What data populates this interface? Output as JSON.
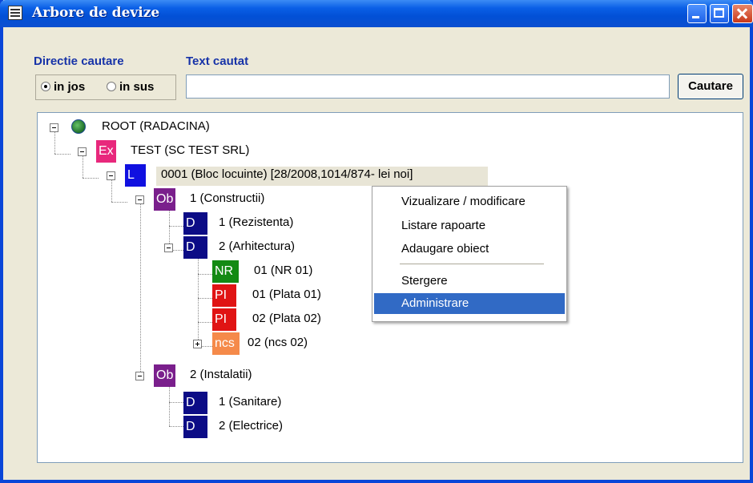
{
  "window": {
    "title": "Arbore de devize"
  },
  "search": {
    "direction_label": "Directie cautare",
    "text_label": "Text cautat",
    "option_down": "in jos",
    "option_up": "in sus",
    "selected_direction": "in jos",
    "text_value": "",
    "button_label": "Cautare"
  },
  "tree": {
    "root": {
      "label": "ROOT (RADACINA)",
      "icon": "globe-icon"
    },
    "test": {
      "tag": "Ex",
      "label": "TEST (SC TEST SRL)"
    },
    "bloc": {
      "tag": "L",
      "label": "0001 (Bloc locuinte) [28/2008,1014/874- lei noi]"
    },
    "constructii": {
      "tag": "Ob",
      "label": "1 (Constructii)"
    },
    "rezistenta": {
      "tag": "D",
      "label": "1 (Rezistenta)"
    },
    "arhitectura": {
      "tag": "D",
      "label": "2 (Arhitectura)"
    },
    "nr01": {
      "tag": "NR",
      "label": "01 (NR 01)"
    },
    "plata01": {
      "tag": "PI",
      "label": "01 (Plata 01)"
    },
    "plata02": {
      "tag": "PI",
      "label": "02 (Plata 02)"
    },
    "ncs02": {
      "tag": "ncs",
      "label": "02 (ncs 02)"
    },
    "instalatii": {
      "tag": "Ob",
      "label": "2 (Instalatii)"
    },
    "sanitare": {
      "tag": "D",
      "label": "1 (Sanitare)"
    },
    "electrice": {
      "tag": "D",
      "label": "2 (Electrice)"
    }
  },
  "tag_colors": {
    "Ex": "#e8287c",
    "L": "#1010e0",
    "Ob": "#7a1f8c",
    "D": "#0c0c86",
    "NR": "#138a13",
    "PI": "#e01414",
    "ncs": "#f58a4a"
  },
  "context_menu": {
    "items": [
      "Vizualizare / modificare",
      "Listare rapoarte",
      "Adaugare obiect",
      "Stergere",
      "Administrare"
    ],
    "highlighted": "Administrare"
  }
}
